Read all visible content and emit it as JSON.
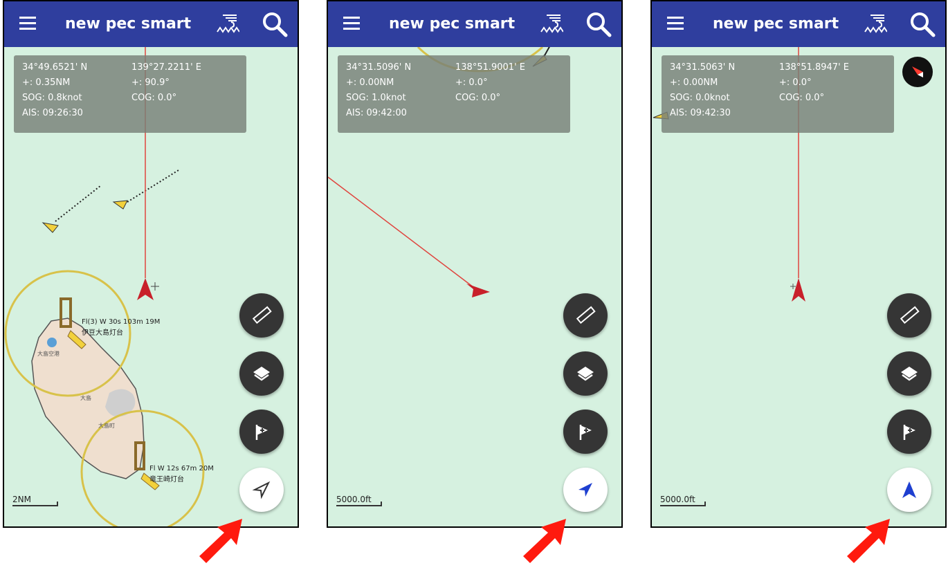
{
  "screens": [
    {
      "app_title": "new pec smart",
      "info": {
        "lat": "34°49.6521' N",
        "lon": "139°27.2211' E",
        "dist": "+: 0.35NM",
        "bearing": "+: 90.9°",
        "sog": "SOG: 0.8knot",
        "cog": "COG: 0.0°",
        "ais": "AIS: 09:26:30"
      },
      "scale": "2NM",
      "map_labels": {
        "light_north": "Fl(3) W 30s 103m 19M",
        "light_north_name": "伊豆大島灯台",
        "airport": "大島空港",
        "island": "大島",
        "town": "大島町",
        "light_south": "Fl W 12s 67m 20M",
        "light_south_name": "竜王崎灯台"
      },
      "location_mode": "north-up outline arrow"
    },
    {
      "app_title": "new pec smart",
      "info": {
        "lat": "34°31.5096' N",
        "lon": "138°51.9001' E",
        "dist": "+: 0.00NM",
        "bearing": "+: 0.0°",
        "sog": "SOG: 1.0knot",
        "cog": "COG: 0.0°",
        "ais": "AIS: 09:42:00"
      },
      "scale": "5000.0ft",
      "location_mode": "follow filled arrow"
    },
    {
      "app_title": "new pec smart",
      "info": {
        "lat": "34°31.5063' N",
        "lon": "138°51.8947' E",
        "dist": "+: 0.00NM",
        "bearing": "+: 0.0°",
        "sog": "SOG: 0.0knot",
        "cog": "COG: 0.0°",
        "ais": "AIS: 09:42:30"
      },
      "scale": "5000.0ft",
      "location_mode": "heading-up navigation arrow"
    }
  ],
  "colors": {
    "appbar": "#2f3e9e",
    "sea": "#d6f1e0",
    "track": "#e0443e",
    "own_ship": "#c8202a",
    "ais_target": "#f2d13c",
    "callout_arrow": "#ff1a0e",
    "fab": "#353535",
    "location_blue": "#1e3fd0"
  },
  "icons": [
    "menu-icon",
    "tide-icon",
    "search-icon",
    "ruler-icon",
    "layers-icon",
    "flag-plus-icon",
    "location-arrow-icon",
    "compass-icon"
  ]
}
